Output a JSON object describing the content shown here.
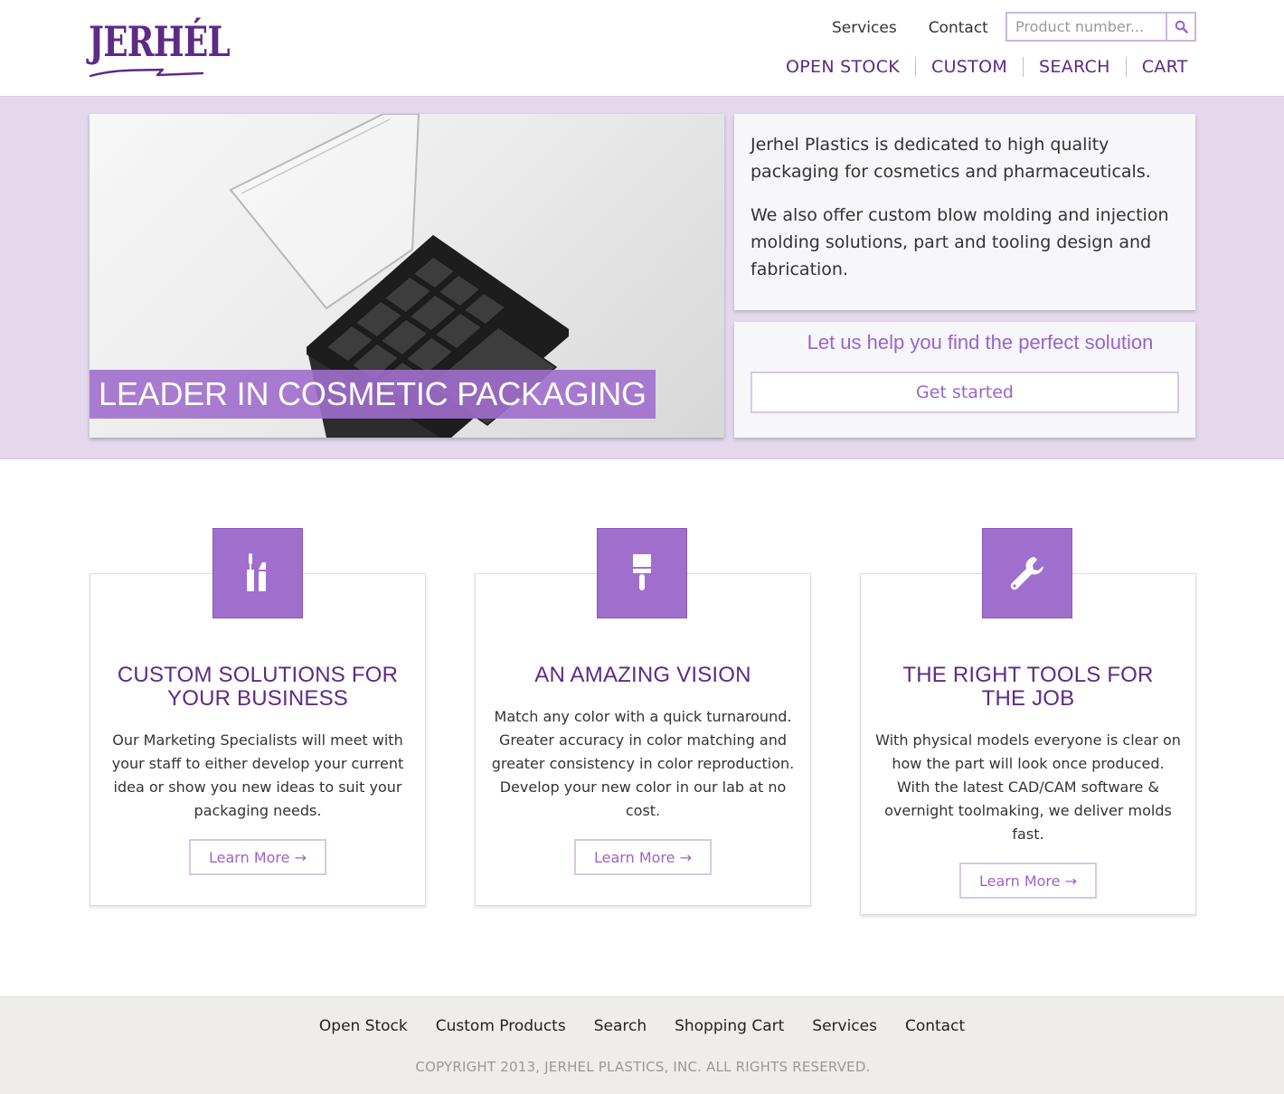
{
  "brand": {
    "logo_text": "JERHÉL",
    "accent": "#a06ecd",
    "dark_purple": "#5e2a86"
  },
  "utility_nav": {
    "services": "Services",
    "contact": "Contact"
  },
  "search": {
    "placeholder": "Product number...",
    "button_icon": "search-icon"
  },
  "main_nav": {
    "items": [
      "OPEN STOCK",
      "CUSTOM",
      "SEARCH",
      "CART"
    ]
  },
  "hero": {
    "caption": "LEADER IN COSMETIC PACKAGING",
    "info_paragraphs": [
      "Jerhel Plastics is dedicated to high quality packaging for cosmetics and pharmaceuticals.",
      "We also offer custom blow molding and injection molding solutions, part and tooling design and fabrication."
    ],
    "cta_text": "Let us help you find the perfect solution",
    "cta_button": "Get started"
  },
  "features": [
    {
      "icon": "mascara-lipstick-icon",
      "title": "CUSTOM SOLUTIONS FOR YOUR BUSINESS",
      "body": "Our Marketing Specialists will meet with your staff to either develop your current idea or show you new ideas to suit your packaging needs.",
      "button": "Learn More →"
    },
    {
      "icon": "paintbrush-icon",
      "title": "AN AMAZING VISION",
      "body": "Match any color with a quick turnaround. Greater accuracy in color matching and greater consistency in color reproduction. Develop your new color in our lab at no cost.",
      "button": "Learn More →"
    },
    {
      "icon": "wrench-icon",
      "title": "THE RIGHT TOOLS FOR THE JOB",
      "body": "With physical models everyone is clear on how the part will look once produced. With the latest CAD/CAM software & overnight toolmaking, we deliver molds fast.",
      "button": "Learn More →"
    }
  ],
  "footer": {
    "links": [
      "Open Stock",
      "Custom Products",
      "Search",
      "Shopping Cart",
      "Services",
      "Contact"
    ],
    "copyright": "COPYRIGHT 2013, JERHEL PLASTICS, INC. ALL RIGHTS RESERVED."
  }
}
